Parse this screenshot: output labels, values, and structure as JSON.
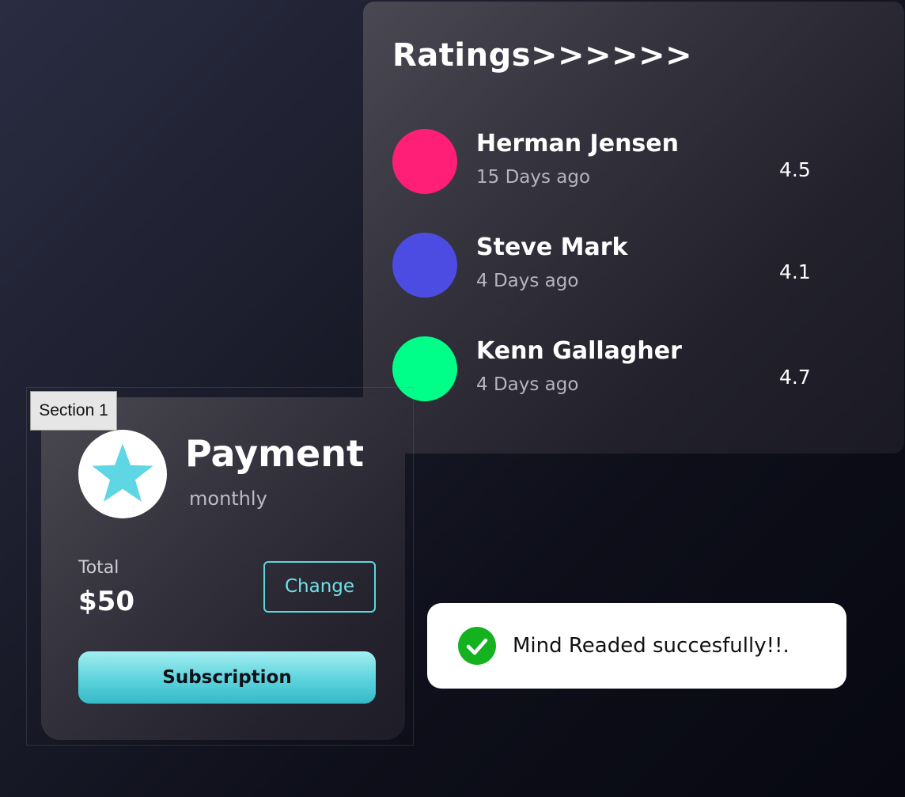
{
  "ratings": {
    "title": "Ratings>>>>>>",
    "items": [
      {
        "name": "Herman Jensen",
        "time": "15 Days ago",
        "score": "4.5",
        "color": "#ff1f76"
      },
      {
        "name": "Steve Mark",
        "time": "4 Days ago",
        "score": "4.1",
        "color": "#4c4ce3"
      },
      {
        "name": "Kenn Gallagher",
        "time": "4 Days ago",
        "score": "4.7",
        "color": "#00ff88"
      }
    ]
  },
  "section_label": "Section 1",
  "payment": {
    "title": "Payment",
    "period": "monthly",
    "total_label": "Total",
    "total_value": "$50",
    "change_label": "Change",
    "subscription_label": "Subscription",
    "icon": "star-icon",
    "accent_color": "#5fd6dd"
  },
  "toast": {
    "message": "Mind Readed succesfully!!.",
    "icon": "check-icon",
    "status_color": "#14b21f"
  }
}
